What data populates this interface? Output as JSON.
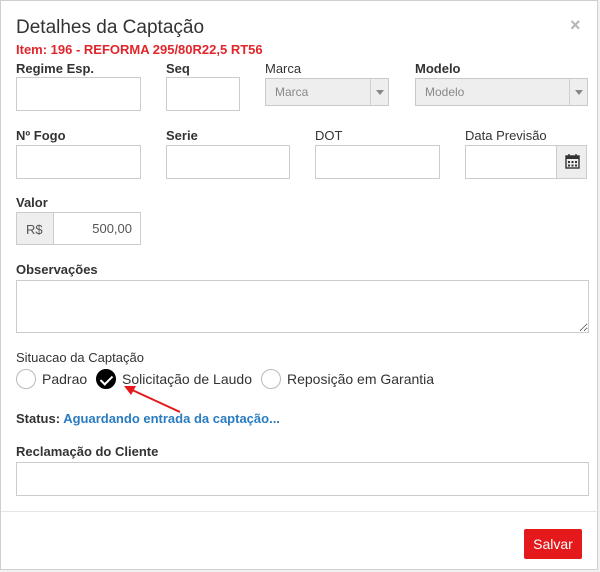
{
  "modal": {
    "title": "Detalhes da Captação",
    "subtitle": "Item: 196 - REFORMA 295/80R22,5 RT56",
    "close_glyph": "×"
  },
  "fields": {
    "regime_label": "Regime Esp.",
    "regime_value": "",
    "seq_label": "Seq",
    "seq_value": "",
    "marca_label": "Marca",
    "marca_selected": "Marca",
    "modelo_label": "Modelo",
    "modelo_selected": "Modelo",
    "fogo_label": "Nº Fogo",
    "fogo_value": "",
    "serie_label": "Serie",
    "serie_value": "",
    "dot_label": "DOT",
    "dot_value": "",
    "data_label": "Data Previsão",
    "data_value": "",
    "valor_label": "Valor",
    "currency": "R$",
    "valor_value": "500,00",
    "obs_label": "Observações",
    "obs_value": ""
  },
  "situacao": {
    "label": "Situacao da Captação",
    "options": [
      {
        "label": "Padrao",
        "checked": false
      },
      {
        "label": "Solicitação de Laudo",
        "checked": true
      },
      {
        "label": "Reposição em Garantia",
        "checked": false
      }
    ]
  },
  "status": {
    "label": "Status:",
    "value": "Aguardando entrada da captação..."
  },
  "reclamacao": {
    "label": "Reclamação do Cliente",
    "value": ""
  },
  "footer": {
    "save_label": "Salvar"
  },
  "icons": [
    "calendar-icon",
    "close-icon",
    "check-icon",
    "annotation-arrow"
  ],
  "colors": {
    "accent_red": "#e3191b",
    "link_blue": "#2a7bc0",
    "subtitle_red": "#e0262d"
  }
}
